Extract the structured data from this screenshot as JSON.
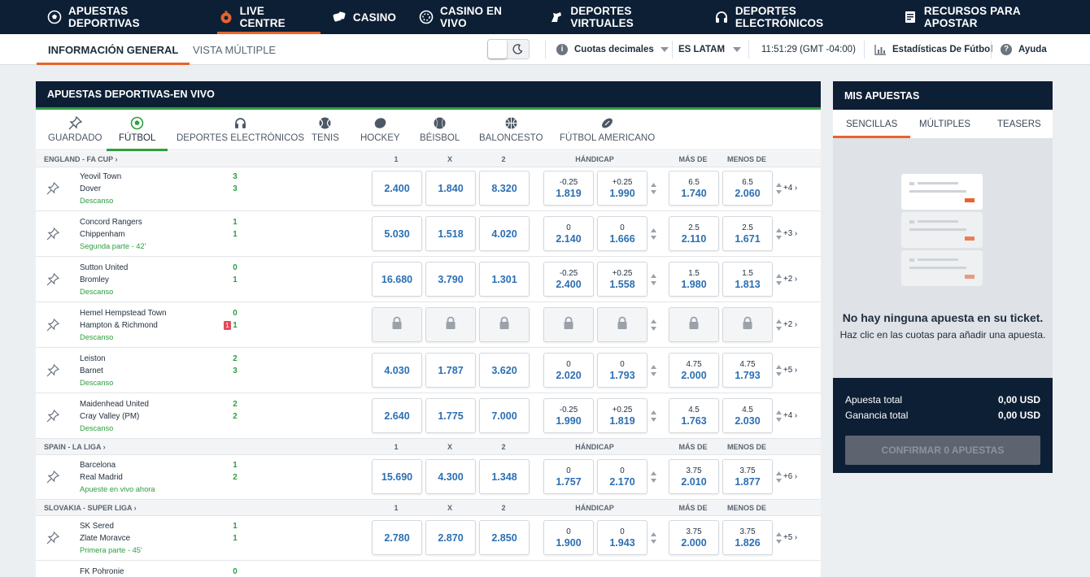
{
  "topnav": [
    {
      "label": "APUESTAS DEPORTIVAS",
      "icon": "soccer-ball-icon",
      "active": false
    },
    {
      "label": "LIVE CENTRE",
      "icon": "live-stopwatch-icon",
      "active": true
    },
    {
      "label": "CASINO",
      "icon": "dice-icon",
      "active": false
    },
    {
      "label": "CASINO EN VIVO",
      "icon": "chip-icon",
      "active": false
    },
    {
      "label": "DEPORTES VIRTUALES",
      "icon": "horse-icon",
      "active": false
    },
    {
      "label": "DEPORTES ELECTRÓNICOS",
      "icon": "headset-icon",
      "active": false
    },
    {
      "label": "RECURSOS PARA APOSTAR",
      "icon": "document-icon",
      "active": false
    }
  ],
  "subnav": {
    "tab_general": "INFORMACIÓN GENERAL",
    "tab_multi": "VISTA MÚLTIPLE",
    "odds_format": "Cuotas decimales",
    "language": "ES LATAM",
    "clock": "11:51:29 (GMT -04:00)",
    "stats": "Estadísticas De Fútbol",
    "help": "Ayuda"
  },
  "main": {
    "title": "APUESTAS DEPORTIVAS-EN VIVO",
    "sport_tabs": [
      {
        "label": "GUARDADO",
        "icon": "pin-icon"
      },
      {
        "label": "FÚTBOL",
        "icon": "soccer-ball-icon"
      },
      {
        "label": "DEPORTES ELECTRÓNICOS",
        "icon": "headset-icon"
      },
      {
        "label": "TENIS",
        "icon": "tennis-ball-icon"
      },
      {
        "label": "HOCKEY",
        "icon": "hockey-puck-icon"
      },
      {
        "label": "BÉISBOL",
        "icon": "baseball-icon"
      },
      {
        "label": "BALONCESTO",
        "icon": "basketball-icon"
      },
      {
        "label": "FÚTBOL AMERICANO",
        "icon": "american-football-icon"
      }
    ],
    "col_headers": [
      "1",
      "X",
      "2",
      "HÁNDICAP",
      "MÁS DE",
      "MENOS DE"
    ],
    "leagues": [
      {
        "name": "ENGLAND - FA CUP"
      },
      {
        "name": "SPAIN - LA LIGA"
      },
      {
        "name": "SLOVAKIA - SUPER LIGA"
      }
    ],
    "matches": [
      {
        "home": "Yeovil Town",
        "away": "Dover",
        "home_score": "3",
        "away_score": "3",
        "status": "Descanso",
        "odds_1": "2.400",
        "odds_x": "1.840",
        "odds_2": "8.320",
        "hcp1_line": "-0.25",
        "hcp1": "1.819",
        "hcp2_line": "+0.25",
        "hcp2": "1.990",
        "over_line": "6.5",
        "over": "1.740",
        "under_line": "6.5",
        "under": "2.060",
        "more": "+4"
      },
      {
        "home": "Concord Rangers",
        "away": "Chippenham",
        "home_score": "1",
        "away_score": "1",
        "status": "Segunda parte - 42'",
        "odds_1": "5.030",
        "odds_x": "1.518",
        "odds_2": "4.020",
        "hcp1_line": "0",
        "hcp1": "2.140",
        "hcp2_line": "0",
        "hcp2": "1.666",
        "over_line": "2.5",
        "over": "2.110",
        "under_line": "2.5",
        "under": "1.671",
        "more": "+3"
      },
      {
        "home": "Sutton United",
        "away": "Bromley",
        "home_score": "0",
        "away_score": "1",
        "status": "Descanso",
        "odds_1": "16.680",
        "odds_x": "3.790",
        "odds_2": "1.301",
        "hcp1_line": "-0.25",
        "hcp1": "2.400",
        "hcp2_line": "+0.25",
        "hcp2": "1.558",
        "over_line": "1.5",
        "over": "1.980",
        "under_line": "1.5",
        "under": "1.813",
        "more": "+2"
      },
      {
        "home": "Hemel Hempstead Town",
        "away": "Hampton & Richmond",
        "home_score": "0",
        "away_score": "1",
        "status": "Descanso",
        "red_card": "1",
        "locked": true,
        "more": "+2"
      },
      {
        "home": "Leiston",
        "away": "Barnet",
        "home_score": "2",
        "away_score": "3",
        "status": "Descanso",
        "odds_1": "4.030",
        "odds_x": "1.787",
        "odds_2": "3.620",
        "hcp1_line": "0",
        "hcp1": "2.020",
        "hcp2_line": "0",
        "hcp2": "1.793",
        "over_line": "4.75",
        "over": "2.000",
        "under_line": "4.75",
        "under": "1.793",
        "more": "+5"
      },
      {
        "home": "Maidenhead United",
        "away": "Cray Valley (PM)",
        "home_score": "2",
        "away_score": "2",
        "status": "Descanso",
        "odds_1": "2.640",
        "odds_x": "1.775",
        "odds_2": "7.000",
        "hcp1_line": "-0.25",
        "hcp1": "1.990",
        "hcp2_line": "+0.25",
        "hcp2": "1.819",
        "over_line": "4.5",
        "over": "1.763",
        "under_line": "4.5",
        "under": "2.030",
        "more": "+4"
      },
      {
        "home": "Barcelona",
        "away": "Real Madrid",
        "home_score": "1",
        "away_score": "2",
        "status": "Apueste en vivo ahora",
        "odds_1": "15.690",
        "odds_x": "4.300",
        "odds_2": "1.348",
        "hcp1_line": "0",
        "hcp1": "1.757",
        "hcp2_line": "0",
        "hcp2": "2.170",
        "over_line": "3.75",
        "over": "2.010",
        "under_line": "3.75",
        "under": "1.877",
        "more": "+6"
      },
      {
        "home": "SK Sered",
        "away": "Zlate Moravce",
        "home_score": "1",
        "away_score": "1",
        "status": "Primera parte - 45'",
        "odds_1": "2.780",
        "odds_x": "2.870",
        "odds_2": "2.850",
        "hcp1_line": "0",
        "hcp1": "1.900",
        "hcp2_line": "0",
        "hcp2": "1.943",
        "over_line": "3.75",
        "over": "2.000",
        "under_line": "3.75",
        "under": "1.826",
        "more": "+5"
      },
      {
        "home": "FK Pohronie",
        "away": "",
        "home_score": "0",
        "away_score": "",
        "status": "",
        "partial": true
      }
    ]
  },
  "slip": {
    "title": "MIS APUESTAS",
    "tabs": [
      "SENCILLAS",
      "MÚLTIPLES",
      "TEASERS"
    ],
    "empty_title": "No hay ninguna apuesta en su ticket.",
    "empty_sub": "Haz clic en las cuotas para añadir una apuesta.",
    "total_stake_label": "Apuesta total",
    "total_stake": "0,00 USD",
    "total_win_label": "Ganancia total",
    "total_win": "0,00 USD",
    "confirm_label": "CONFIRMAR 0 APUESTAS"
  },
  "colors": {
    "navy": "#0d1f35",
    "accent_orange": "#e8632b",
    "live_green": "#2e9e3e",
    "odds_blue": "#2c6fb3"
  }
}
